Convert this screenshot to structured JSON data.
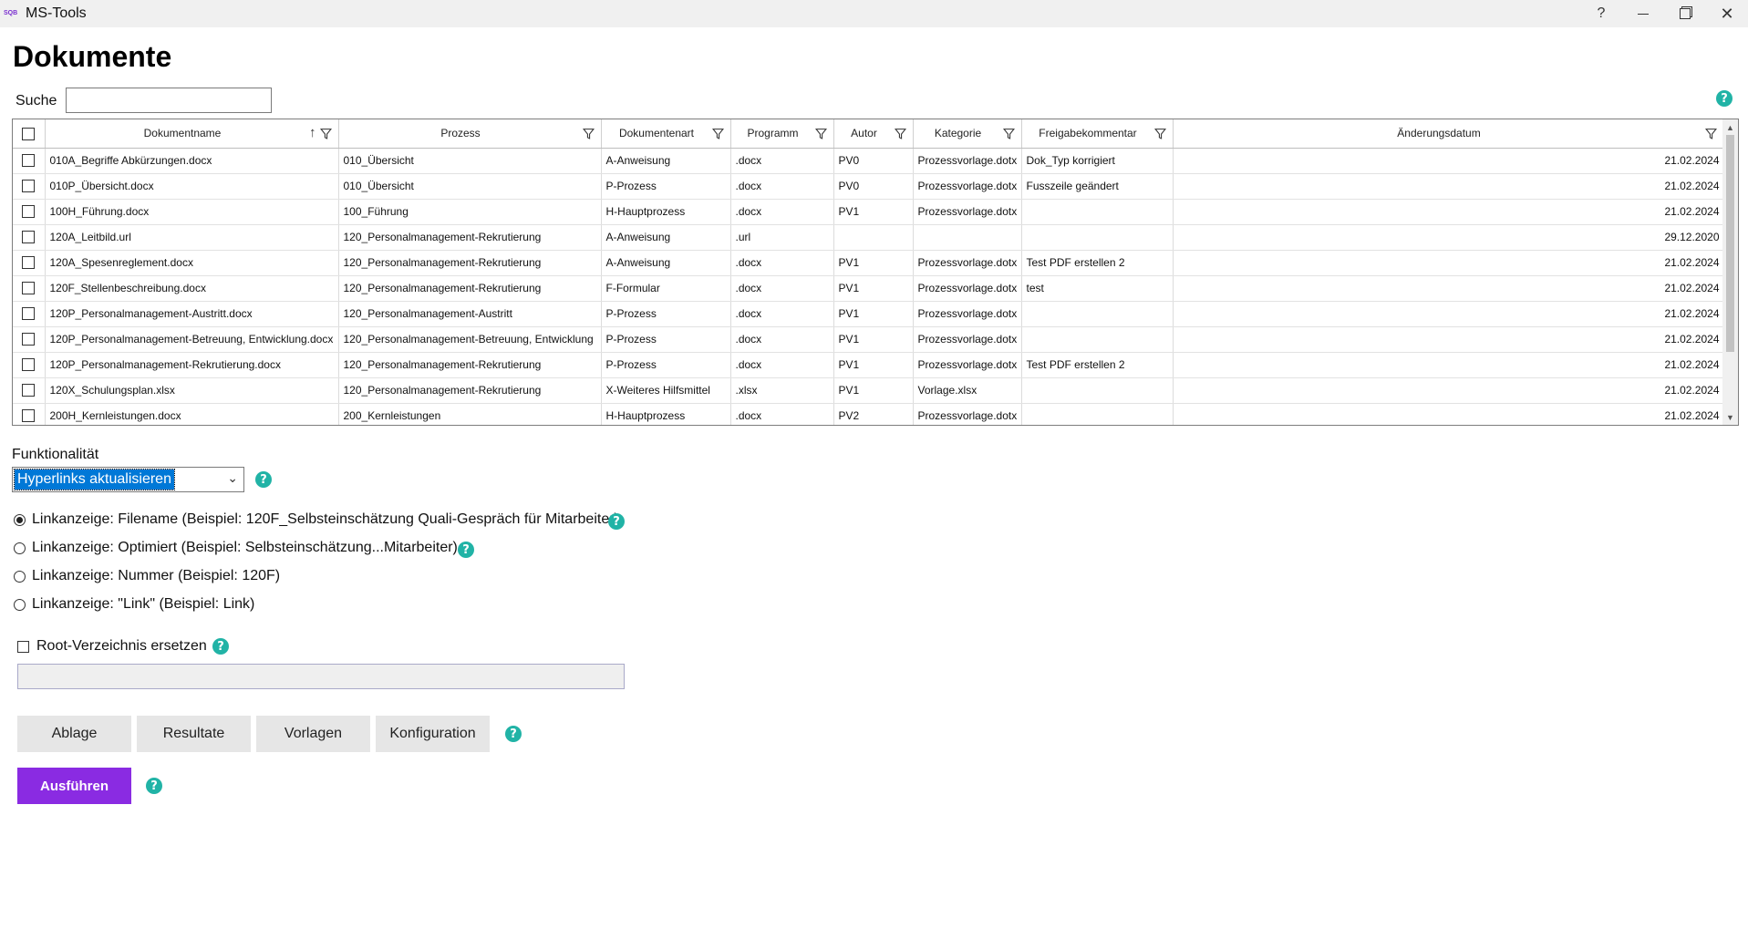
{
  "window": {
    "title": "MS-Tools",
    "controls": {
      "help": "?",
      "close": "✕"
    }
  },
  "page": {
    "title": "Dokumente"
  },
  "search": {
    "label": "Suche",
    "value": "",
    "placeholder": ""
  },
  "help_glyph": "?",
  "grid": {
    "columns": [
      {
        "label": "Dokumentname",
        "sorted": "ascending"
      },
      {
        "label": "Prozess"
      },
      {
        "label": "Dokumentenart"
      },
      {
        "label": "Programm"
      },
      {
        "label": "Autor"
      },
      {
        "label": "Kategorie"
      },
      {
        "label": "Freigabekommentar"
      },
      {
        "label": "Änderungsdatum"
      }
    ],
    "rows": [
      [
        "010A_Begriffe Abkürzungen.docx",
        "010_Übersicht",
        "A-Anweisung",
        ".docx",
        "PV0",
        "Prozessvorlage.dotx",
        "Dok_Typ korrigiert",
        "21.02.2024"
      ],
      [
        "010P_Übersicht.docx",
        "010_Übersicht",
        "P-Prozess",
        ".docx",
        "PV0",
        "Prozessvorlage.dotx",
        "Fusszeile geändert",
        "21.02.2024"
      ],
      [
        "100H_Führung.docx",
        "100_Führung",
        "H-Hauptprozess",
        ".docx",
        "PV1",
        "Prozessvorlage.dotx",
        "",
        "21.02.2024"
      ],
      [
        "120A_Leitbild.url",
        "120_Personalmanagement-Rekrutierung",
        "A-Anweisung",
        ".url",
        "",
        "",
        "",
        "29.12.2020"
      ],
      [
        "120A_Spesenreglement.docx",
        "120_Personalmanagement-Rekrutierung",
        "A-Anweisung",
        ".docx",
        "PV1",
        "Prozessvorlage.dotx",
        "Test PDF erstellen 2",
        "21.02.2024"
      ],
      [
        "120F_Stellenbeschreibung.docx",
        "120_Personalmanagement-Rekrutierung",
        "F-Formular",
        ".docx",
        "PV1",
        "Prozessvorlage.dotx",
        "test",
        "21.02.2024"
      ],
      [
        "120P_Personalmanagement-Austritt.docx",
        "120_Personalmanagement-Austritt",
        "P-Prozess",
        ".docx",
        "PV1",
        "Prozessvorlage.dotx",
        "",
        "21.02.2024"
      ],
      [
        "120P_Personalmanagement-Betreuung, Entwicklung.docx",
        "120_Personalmanagement-Betreuung, Entwicklung",
        "P-Prozess",
        ".docx",
        "PV1",
        "Prozessvorlage.dotx",
        "",
        "21.02.2024"
      ],
      [
        "120P_Personalmanagement-Rekrutierung.docx",
        "120_Personalmanagement-Rekrutierung",
        "P-Prozess",
        ".docx",
        "PV1",
        "Prozessvorlage.dotx",
        "Test PDF erstellen 2",
        "21.02.2024"
      ],
      [
        "120X_Schulungsplan.xlsx",
        "120_Personalmanagement-Rekrutierung",
        "X-Weiteres Hilfsmittel",
        ".xlsx",
        "PV1",
        "Vorlage.xlsx",
        "",
        "21.02.2024"
      ],
      [
        "200H_Kernleistungen.docx",
        "200_Kernleistungen",
        "H-Hauptprozess",
        ".docx",
        "PV2",
        "Prozessvorlage.dotx",
        "",
        "21.02.2024"
      ]
    ]
  },
  "functionality": {
    "label": "Funktionalität",
    "selected": "Hyperlinks aktualisieren"
  },
  "link_options": [
    {
      "label": "Linkanzeige: Filename (Beispiel: 120F_Selbsteinschätzung Quali-Gespräch für Mitarbeiter)",
      "selected": true,
      "help": true
    },
    {
      "label": "Linkanzeige: Optimiert (Beispiel: Selbsteinschätzung...Mitarbeiter)",
      "selected": false,
      "help": true
    },
    {
      "label": "Linkanzeige: Nummer (Beispiel: 120F)",
      "selected": false,
      "help": false
    },
    {
      "label": "Linkanzeige: \"Link\" (Beispiel: Link)",
      "selected": false,
      "help": false
    }
  ],
  "root": {
    "label": "Root-Verzeichnis ersetzen",
    "checked": false,
    "path_value": ""
  },
  "buttons": {
    "ablage": "Ablage",
    "resultate": "Resultate",
    "vorlagen": "Vorlagen",
    "konfiguration": "Konfiguration",
    "run": "Ausführen"
  },
  "colors": {
    "accent": "#8a2be2",
    "help": "#21b3a6",
    "selection": "#0078d7"
  }
}
